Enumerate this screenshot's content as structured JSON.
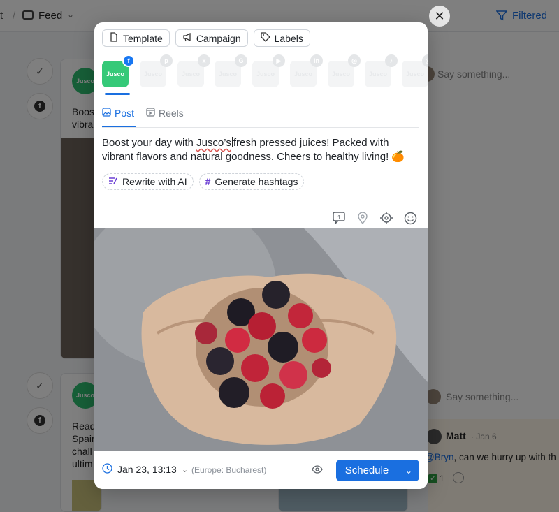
{
  "background": {
    "breadcrumb_prefix": "t",
    "breadcrumb_slash": "/",
    "feed_label": "Feed",
    "filter_label": "Filtered",
    "card1": {
      "avatar": "Jusco",
      "text_line1": "Boos",
      "text_line2": "vibra"
    },
    "card2": {
      "avatar": "Jusco",
      "lines": [
        "Read",
        "Spair",
        "chall",
        "ultim"
      ]
    },
    "comment_placeholder": "Say something...",
    "comment": {
      "author": "Matt",
      "date": "· Jan 6",
      "mention": "@Bryn",
      "message": ", can we hurry up with th",
      "reaction_count": "1"
    }
  },
  "modal": {
    "top_actions": [
      {
        "label": "Template",
        "icon": "file-icon"
      },
      {
        "label": "Campaign",
        "icon": "megaphone-icon"
      },
      {
        "label": "Labels",
        "icon": "tag-icon"
      }
    ],
    "channels": [
      {
        "logo": "Jusco",
        "network": "facebook",
        "badge": "f",
        "active": true
      },
      {
        "logo": "Jusco",
        "network": "pinterest",
        "badge": "p",
        "active": false
      },
      {
        "logo": "Jusco",
        "network": "x",
        "badge": "x",
        "active": false
      },
      {
        "logo": "Jusco",
        "network": "google",
        "badge": "G",
        "active": false
      },
      {
        "logo": "Jusco",
        "network": "youtube",
        "badge": "▶",
        "active": false
      },
      {
        "logo": "Jusco",
        "network": "linkedin",
        "badge": "in",
        "active": false
      },
      {
        "logo": "Jusco",
        "network": "instagram",
        "badge": "◎",
        "active": false
      },
      {
        "logo": "Jusco",
        "network": "tiktok",
        "badge": "♪",
        "active": false
      },
      {
        "logo": "Jusco",
        "network": "threads",
        "badge": "@",
        "active": false
      }
    ],
    "tabs": {
      "post": "Post",
      "reels": "Reels"
    },
    "post_text": {
      "part1": "Boost your day with ",
      "misspelled": "Jusco’s",
      "part2": "fresh pressed juices! Packed with vibrant flavors and natural goodness. Cheers to healthy living! 🍊"
    },
    "ai_buttons": {
      "rewrite": "Rewrite with AI",
      "hashtags": "Generate hashtags"
    },
    "footer": {
      "date": "Jan 23, 13:13",
      "timezone": "(Europe: Bucharest)",
      "schedule": "Schedule"
    }
  },
  "colors": {
    "accent": "#1a6fe0",
    "brand": "#35c978",
    "facebook": "#1877f2"
  }
}
